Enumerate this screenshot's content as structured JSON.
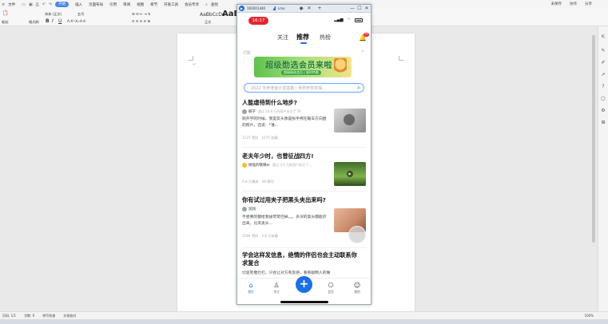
{
  "wps": {
    "menubar": {
      "file": "文件",
      "tabs": [
        "开始",
        "插入",
        "页面布局",
        "引用",
        "审阅",
        "视图",
        "章节",
        "开发工具",
        "会员专享"
      ],
      "search": "查找",
      "right": [
        "未保存",
        "协作",
        "分享"
      ]
    },
    "ribbon": {
      "paste": "粘贴",
      "format_painter": "格式刷",
      "font_name": "宋体 (正文)",
      "font_size": "五号",
      "style1_preview": "AaBbCcDd",
      "style1_name": "正文",
      "style2_preview": "AaBb",
      "bold": "B",
      "italic": "I",
      "underline": "U"
    },
    "status": {
      "page": "页码: 1/1",
      "words": "字数: 0",
      "spell": "拼写检查",
      "doc_check": "文档校对",
      "zoom": "100%"
    }
  },
  "phone": {
    "window_title": "1920X1440",
    "window_tag": "Lmx",
    "window_buttons": [
      "—",
      "☐",
      "✕"
    ],
    "status_time": "16:17",
    "tabs": {
      "follow": "关注",
      "recommend": "推荐",
      "hot": "热榜"
    },
    "bell_badge": "99",
    "banner": {
      "ad_tag": "广告",
      "title": "超级勋选会员来啦",
      "sub": "超级勋选会员 | 限时特惠"
    },
    "search_placeholder": "2022 年养老金计发基数 | 世界杯你觉得...",
    "feed": [
      {
        "title": "人能虐待到什么地步?",
        "author": "楠子",
        "meta": "超过 16.8 万的用户关注了 TA",
        "text": "刚开学的时候，我室友头像是张手拷在暖车方向盘的照片，还说：「谁...",
        "stats": "1137 赞同 · 1075 收藏"
      },
      {
        "title": "老夫年少时，也曾征战四方!",
        "author": "搞怪的铁锹er",
        "meta": "超过 3.4 万的用户关注了...",
        "text": "",
        "stats": "6.8 万播放 · 58 赞同"
      },
      {
        "title": "你有试过用夹子把黑头夹出来吗?",
        "author": "润润",
        "meta": "",
        "text": "不想要的都给我拔苛苛巴掉。。。多深的黑头都能挤出来，比夹黑头...",
        "stats": "3584 赞同 · 5.8 万收藏"
      },
      {
        "title": "学会这样发信息，绝情的伴侣也会主动联系你求复合",
        "author": "",
        "meta": "",
        "text": "切忌死缠烂打。只会让对方有反感，看看聪明人的做",
        "stats": ""
      }
    ],
    "nav": [
      {
        "label": "首页",
        "icon": "home-icon"
      },
      {
        "label": "关注",
        "icon": "person-icon"
      },
      {
        "label": "",
        "icon": "plus-icon"
      },
      {
        "label": "会员",
        "icon": "bag-icon"
      },
      {
        "label": "我的",
        "icon": "smile-icon"
      }
    ]
  },
  "colors": {
    "accent": "#1b6fe8",
    "red": "#e5262f",
    "wps_active_tab": "#4a86e8"
  }
}
